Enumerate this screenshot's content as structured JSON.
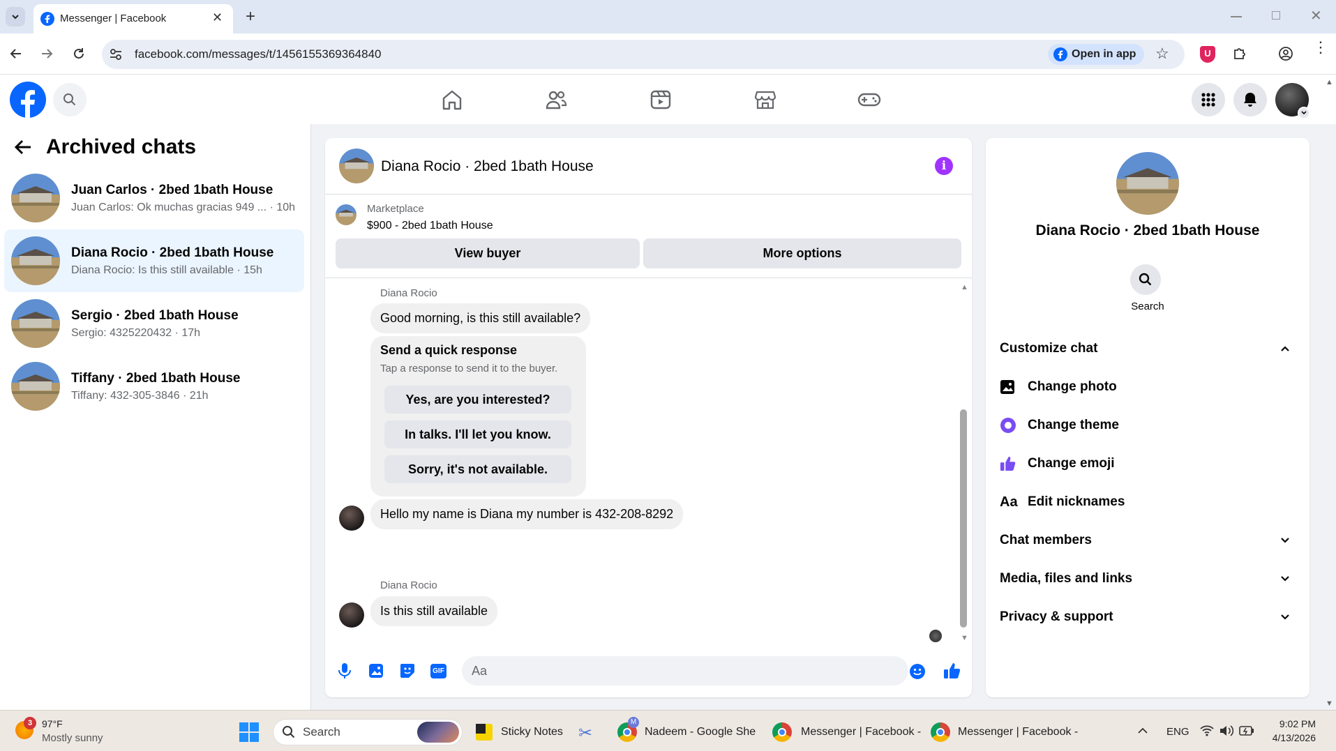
{
  "browser": {
    "tab_title": "Messenger | Facebook",
    "url": "facebook.com/messages/t/1456155369364840",
    "open_in_app": "Open in app"
  },
  "sidebar": {
    "title": "Archived chats",
    "chats": [
      {
        "name": "Juan Carlos · 2bed 1bath House",
        "preview": "Juan Carlos: Ok muchas gracias 949 ... · 10h"
      },
      {
        "name": "Diana Rocio · 2bed 1bath House",
        "preview": "Diana Rocio: Is this still available · 15h"
      },
      {
        "name": "Sergio · 2bed 1bath House",
        "preview": "Sergio: 4325220432 · 17h"
      },
      {
        "name": "Tiffany · 2bed 1bath House",
        "preview": "Tiffany: 432-305-3846 · 21h"
      }
    ]
  },
  "conversation": {
    "title": "Diana Rocio · 2bed 1bath House",
    "marketplace_label": "Marketplace",
    "listing": "$900 - 2bed 1bath House",
    "view_buyer": "View buyer",
    "more_options": "More options",
    "sender1": "Diana Rocio",
    "msg1": "Good morning, is this still available?",
    "quick_title": "Send a quick response",
    "quick_sub": "Tap a response to send it to the buyer.",
    "quick_responses": [
      "Yes, are you interested?",
      "In talks. I'll let you know.",
      "Sorry, it's not available."
    ],
    "msg2": "Hello my name is Diana my number is 432-208-8292",
    "sender2": "Diana Rocio",
    "msg3": "Is this still available",
    "composer_placeholder": "Aa"
  },
  "info_panel": {
    "name": "Diana Rocio · 2bed 1bath House",
    "search_label": "Search",
    "customize": "Customize chat",
    "change_photo": "Change photo",
    "change_theme": "Change theme",
    "change_emoji": "Change emoji",
    "edit_nicknames": "Edit nicknames",
    "chat_members": "Chat members",
    "media": "Media, files and links",
    "privacy": "Privacy & support",
    "nickname_glyph": "Aa"
  },
  "taskbar": {
    "weather_badge": "3",
    "temp": "97°F",
    "weather": "Mostly sunny",
    "search": "Search",
    "apps": [
      "Sticky Notes",
      "Nadeem - Google Shee",
      "Messenger | Facebook -",
      "Messenger | Facebook -"
    ],
    "lang": "ENG",
    "time": "9:02 PM",
    "date": "4/13/2026"
  },
  "colors": {
    "fb_blue": "#0866ff",
    "accent_purple": "#a033ff",
    "active_row": "#ebf5ff"
  }
}
